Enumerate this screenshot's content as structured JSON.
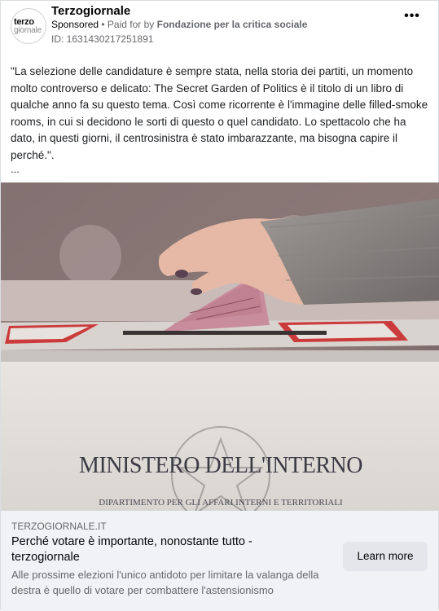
{
  "post": {
    "page_name": "Terzogiornale",
    "sponsored_label": "Sponsored",
    "paid_for_prefix": "• Paid for by",
    "payer": "Fondazione per la critica sociale",
    "ad_id": "ID: 1631430217251891",
    "more_icon": "more-horizontal-icon",
    "avatar_text_1": "terzo",
    "avatar_text_2": "giornale",
    "body": "\"La selezione delle candidature è sempre stata, nella storia dei partiti, un momento molto controverso e delicato: The Secret Garden of Politics è il titolo di un libro di qualche anno fa su questo tema. Così come ricorrente è l'immagine delle filled-smoke rooms, in cui si decidono le sorti di questo o quel candidato. Lo spettacolo che ha dato, in questi giorni, il centrosinistra è stato imbarazzante, ma bisogna capire il perché.\".",
    "ellipsis": "..."
  },
  "image": {
    "box_text_main": "MINISTERO DELL'INTERNO",
    "box_text_sub": "DIPARTIMENTO PER GLI AFFARI INTERNI E TERRITORIALI"
  },
  "link_preview": {
    "domain": "TERZOGIORNALE.IT",
    "headline": "Perché votare è importante, nonostante tutto - terzogiornale",
    "description": "Alle prossime elezioni l'unico antidoto per limitare la valanga della destra è quello di votare per combattere l'astensionismo",
    "cta_label": "Learn more"
  }
}
